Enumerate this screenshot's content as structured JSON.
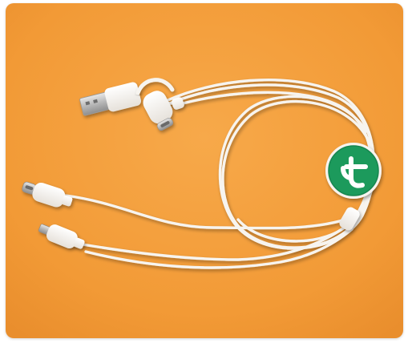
{
  "image": {
    "alt": "",
    "background_color": "#F4A03F",
    "cable_color": "#F7F4EF",
    "badge_color": "#1E9A5C",
    "badge_icon": "ct-logo-icon"
  }
}
